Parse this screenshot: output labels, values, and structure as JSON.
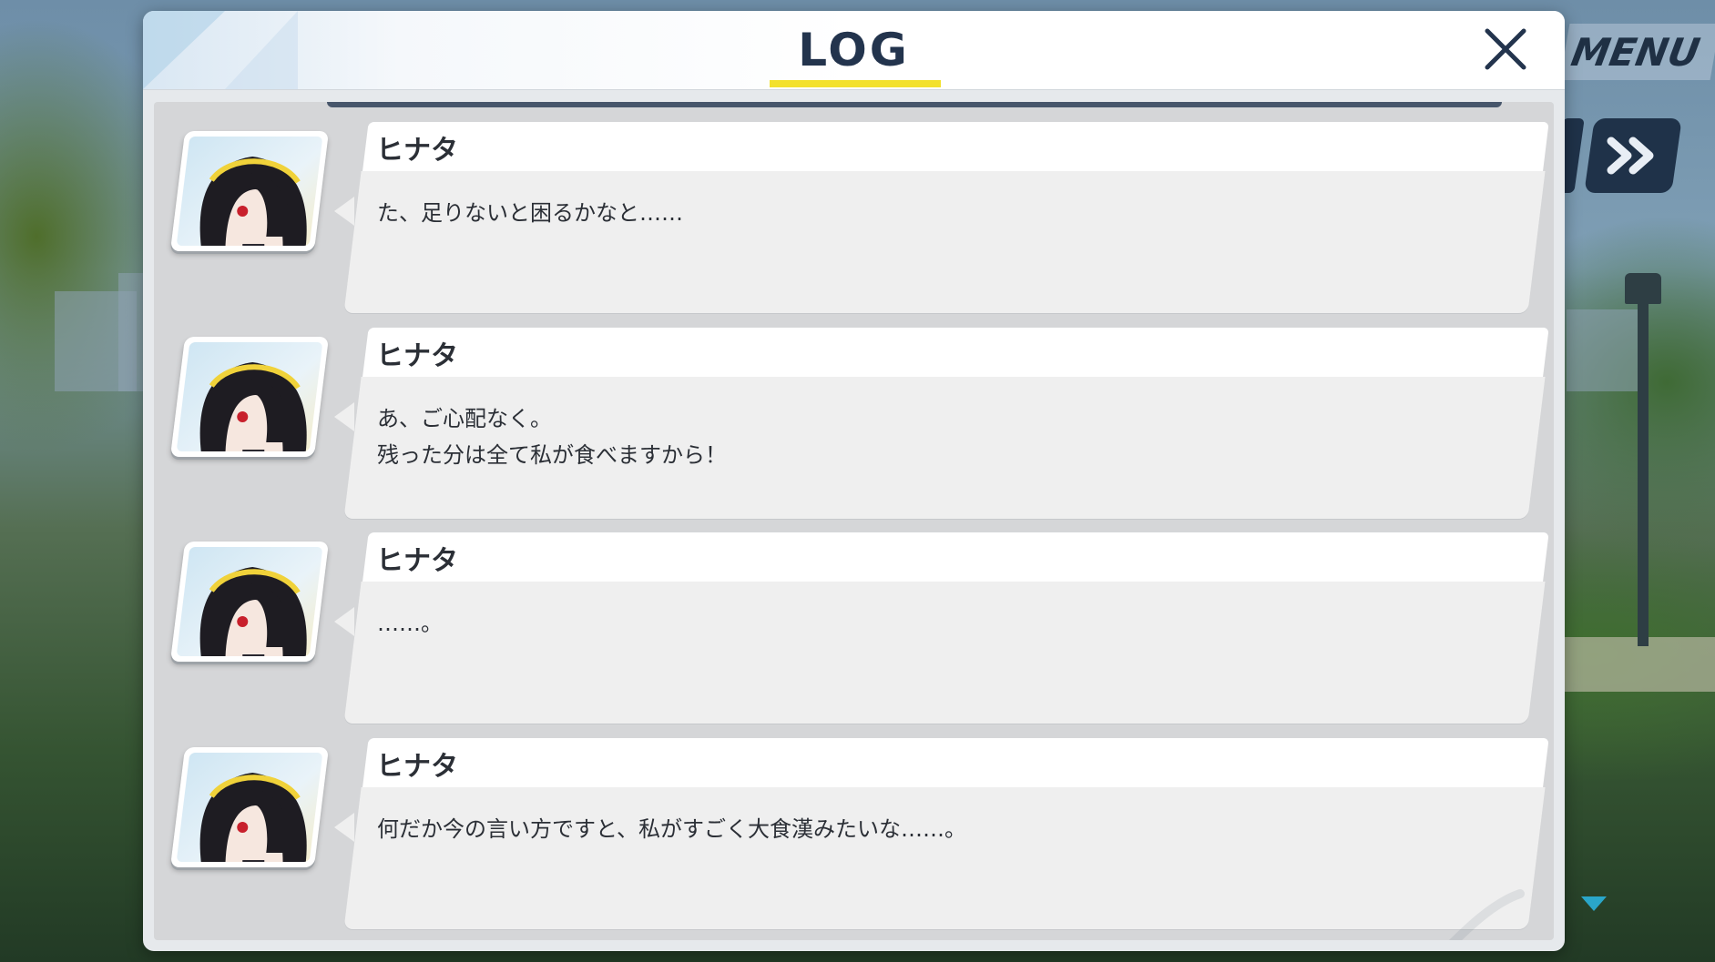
{
  "hud": {
    "menu_label": "MENU"
  },
  "log_panel": {
    "title": "LOG",
    "accent_color": "#f3e12c",
    "entries": [
      {
        "speaker": "ヒナタ",
        "text": "た、足りないと困るかなと……"
      },
      {
        "speaker": "ヒナタ",
        "text": "あ、ご心配なく。\n残った分は全て私が食べますから！"
      },
      {
        "speaker": "ヒナタ",
        "text": "……。"
      },
      {
        "speaker": "ヒナタ",
        "text": "何だか今の言い方ですと、私がすごく大食漢みたいな……。"
      }
    ]
  }
}
